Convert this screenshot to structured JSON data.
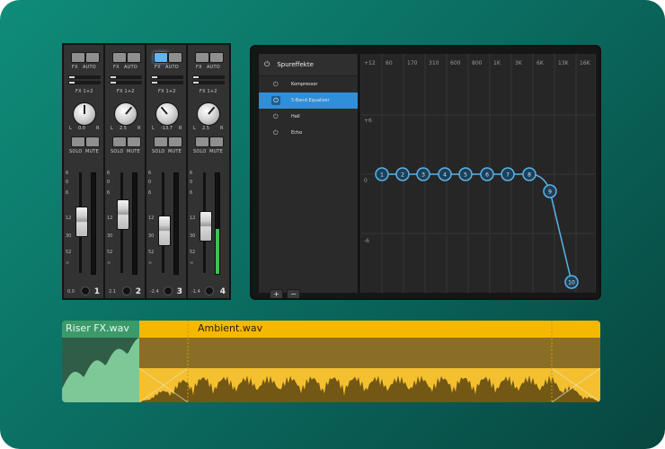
{
  "mixer": {
    "channels": [
      {
        "number": "1",
        "fx": "FX",
        "auto": "AUTO",
        "send": "FX 1+2",
        "knob_l": "L",
        "knob_r": "R",
        "knob_value": "0.0",
        "solo": "SOLO",
        "mute": "MUTE",
        "fader_value": "0.0",
        "fx_active": false,
        "knob_angle": 0,
        "fader_pos": 0.52,
        "meter_level": 0.0
      },
      {
        "number": "2",
        "fx": "FX",
        "auto": "AUTO",
        "send": "FX 1+2",
        "knob_l": "L",
        "knob_r": "R",
        "knob_value": "2.5",
        "solo": "SOLO",
        "mute": "MUTE",
        "fader_value": "2.1",
        "fx_active": false,
        "knob_angle": 40,
        "fader_pos": 0.62,
        "meter_level": 0.0
      },
      {
        "number": "3",
        "fx": "FX",
        "auto": "AUTO",
        "send": "FX 1+2",
        "knob_l": "L",
        "knob_r": "R",
        "knob_value": "-13.7",
        "solo": "SOLO",
        "mute": "MUTE",
        "fader_value": "-2.4",
        "fx_active": true,
        "knob_angle": -40,
        "fader_pos": 0.4,
        "meter_level": 0.0
      },
      {
        "number": "4",
        "fx": "FX",
        "auto": "AUTO",
        "send": "FX 1+2",
        "knob_l": "L",
        "knob_r": "R",
        "knob_value": "2.5",
        "solo": "SOLO",
        "mute": "MUTE",
        "fader_value": "-1.4",
        "fx_active": false,
        "knob_angle": 40,
        "fader_pos": 0.46,
        "meter_level": 0.45
      }
    ],
    "scale_labels": [
      "6",
      "0",
      "6",
      "12",
      "30",
      "52",
      "∞"
    ]
  },
  "fx_window": {
    "title": "Spureffekte",
    "items": [
      {
        "label": "Kompressor",
        "selected": false
      },
      {
        "label": "5-Band-Equalizer",
        "selected": true
      },
      {
        "label": "Hall",
        "selected": false
      },
      {
        "label": "Echo",
        "selected": false
      }
    ],
    "add_label": "+",
    "remove_label": "−",
    "eq": {
      "freq_labels": [
        "+12",
        "60",
        "170",
        "310",
        "600",
        "800",
        "1K",
        "3K",
        "6K",
        "13K",
        "16K"
      ],
      "gain_labels": [
        "+6",
        "0",
        "-6"
      ],
      "nodes": [
        "1",
        "2",
        "3",
        "4",
        "5",
        "6",
        "7",
        "8",
        "9",
        "10"
      ]
    }
  },
  "timeline": {
    "clip_left": "Riser FX.wav",
    "clip_main": "Ambient.wav"
  },
  "colors": {
    "accent": "#2f8fd8",
    "eq_node": "#5ab4e8",
    "clip_green": "#7dc896",
    "clip_yellow": "#f5b800"
  }
}
